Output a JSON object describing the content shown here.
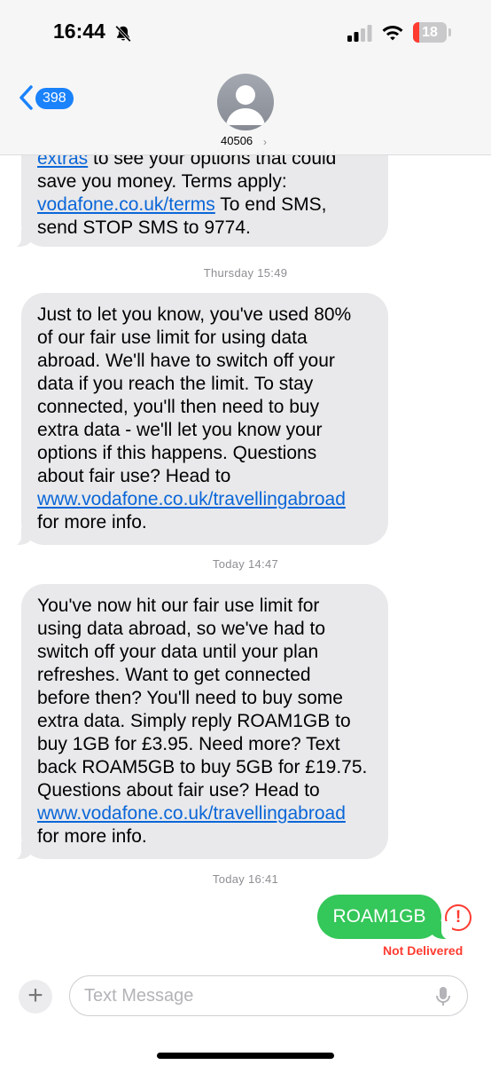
{
  "status_bar": {
    "time": "16:44",
    "battery": "18",
    "icons": [
      "bell-slash-icon",
      "cellular-signal-icon",
      "wifi-icon",
      "battery-icon"
    ]
  },
  "nav": {
    "back_badge": "398",
    "contact": "40506"
  },
  "messages": {
    "m1": {
      "lines": [
        "extras to see your options that could",
        "save you money. Terms apply:",
        "To end SMS,",
        "send STOP SMS to 9774."
      ],
      "link_extras": "extras",
      "link_terms": "vodafone.co.uk/terms"
    },
    "ts1": "Thursday 15:49",
    "m2": {
      "lines": [
        "Just to let you know, you've used 80%",
        "of our fair use limit for using data",
        "abroad. We'll have to switch off your",
        "data if you reach the limit. To stay",
        "connected, you'll then need to buy",
        "extra data - we'll let you know your",
        "options if this happens. Questions",
        "about fair use? Head to",
        "for more info."
      ],
      "link": "www.vodafone.co.uk/travellingabroad"
    },
    "ts2": "Today 14:47",
    "m3": {
      "lines": [
        "You've now hit our fair use limit for",
        "using data abroad, so we've had to",
        "switch off your data until your plan",
        "refreshes. Want to get connected",
        "before then? You'll need to buy some",
        "extra data. Simply reply ROAM1GB to",
        "buy 1GB for £3.95. Need more? Text",
        "back ROAM5GB to buy 5GB for £19.75.",
        "Questions about fair use? Head to",
        "for more info."
      ],
      "link": "www.vodafone.co.uk/travellingabroad"
    },
    "ts3": "Today 16:41",
    "outgoing": "ROAM1GB",
    "error_mark": "!",
    "delivery_status": "Not Delivered"
  },
  "composer": {
    "placeholder": "Text Message",
    "plus": "+"
  },
  "colors": {
    "incoming_bubble": "#e9e9eb",
    "outgoing_bubble": "#34c759",
    "link": "#0a66d8",
    "error": "#ff3b30",
    "badge": "#1a82fb"
  }
}
